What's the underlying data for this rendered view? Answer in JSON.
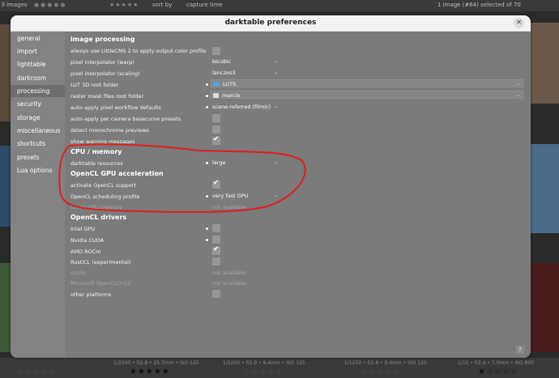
{
  "app": {
    "topbar": {
      "collection": "ll images",
      "sort_by": "sort by",
      "sort_value": "capture time",
      "status": "1 image (#64) selected of 70"
    },
    "thumb_meta": [
      "1/2500 • f/2.8 • 25.7mm • ISO 125",
      "1/1250 • f/2.8 • 9.4mm • ISO 125",
      "1/1250 • f/2.8 • 9.4mm • ISO 125",
      "1/15 • f/2.4 • 7.0mm • ISO 800"
    ]
  },
  "dialog": {
    "title": "darktable preferences",
    "close_glyph": "×",
    "help_glyph": "?"
  },
  "sidebar": {
    "items": [
      {
        "label": "general"
      },
      {
        "label": "import"
      },
      {
        "label": "lighttable"
      },
      {
        "label": "darkroom"
      },
      {
        "label": "processing",
        "active": true
      },
      {
        "label": "security"
      },
      {
        "label": "storage"
      },
      {
        "label": "miscellaneous"
      },
      {
        "label": "shortcuts"
      },
      {
        "label": "presets"
      },
      {
        "label": "Lua options"
      }
    ]
  },
  "content": {
    "image_processing": {
      "heading": "image processing",
      "rows": [
        {
          "label": "always use LittleCMS 2 to apply output color profile",
          "type": "check",
          "checked": false
        },
        {
          "label": "pixel interpolator (warp)",
          "type": "combo",
          "value": "bicubic"
        },
        {
          "label": "pixel interpolator (scaling)",
          "type": "combo",
          "value": "lanczos3"
        },
        {
          "label": "LUT 3D root folder",
          "type": "path",
          "value": "LUTS",
          "modified": true,
          "icon": "folder-icon"
        },
        {
          "label": "raster mask files root folder",
          "type": "path",
          "value": "marcio",
          "modified": true,
          "icon": "camera-icon"
        },
        {
          "label": "auto-apply pixel workflow defaults",
          "type": "combo",
          "value": "scene-referred (filmic)",
          "modified": true
        },
        {
          "label": "auto-apply per camera basecurve presets",
          "type": "check",
          "checked": false
        },
        {
          "label": "detect monochrome previews",
          "type": "check",
          "checked": false
        },
        {
          "label": "show warning messages",
          "type": "check",
          "checked": true
        }
      ]
    },
    "cpu_memory": {
      "heading": "CPU / memory",
      "rows": [
        {
          "label": "darktable resources",
          "type": "combo",
          "value": "large",
          "modified": true
        }
      ]
    },
    "opencl": {
      "heading": "OpenCL GPU acceleration",
      "rows": [
        {
          "label": "activate OpenCL support",
          "type": "check",
          "checked": true
        },
        {
          "label": "OpenCL scheduling profile",
          "type": "combo",
          "value": "very fast GPU",
          "modified": true
        },
        {
          "label": "tuned GPU memory",
          "type": "na",
          "value": "not available",
          "muted": true
        }
      ]
    },
    "opencl_drivers": {
      "heading": "OpenCL drivers",
      "rows": [
        {
          "label": "Intel GPU",
          "type": "check",
          "checked": false,
          "modified": true
        },
        {
          "label": "Nvidia CUDA",
          "type": "check",
          "checked": false,
          "modified": true
        },
        {
          "label": "AMD ROCm",
          "type": "check",
          "checked": true
        },
        {
          "label": "RustiCL (experimental)",
          "type": "check",
          "checked": false
        },
        {
          "label": "Apple",
          "type": "na",
          "value": "not available",
          "muted": true
        },
        {
          "label": "Microsoft OpenCLOn12",
          "type": "na",
          "value": "not available",
          "muted": true
        },
        {
          "label": "other platforms",
          "type": "check",
          "checked": false
        }
      ]
    }
  },
  "colors": {
    "dialog_bg": "#7b7b7b",
    "sidebar_bg": "#838383",
    "annotation_red": "#e0201e",
    "folder_blue": "#5aa0e0"
  }
}
